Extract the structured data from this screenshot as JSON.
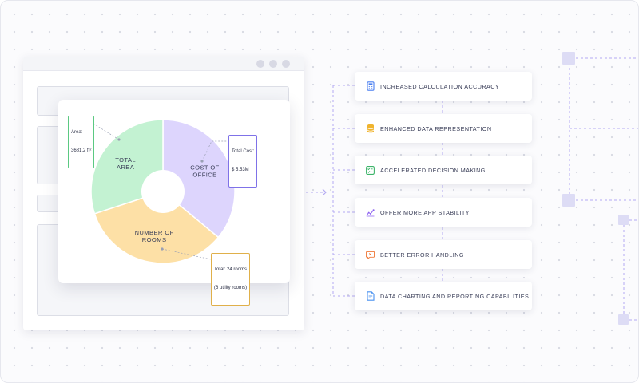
{
  "chart_data": {
    "type": "pie",
    "title": "",
    "slices": [
      {
        "label": "COST OF OFFICE",
        "lines": [
          "COST OF",
          "OFFICE"
        ],
        "value": 36,
        "color": "#ddd5fd"
      },
      {
        "label": "NUMBER OF ROOMS",
        "lines": [
          "NUMBER OF",
          "ROOMS"
        ],
        "value": 34,
        "color": "#fde0a6"
      },
      {
        "label": "TOTAL AREA",
        "lines": [
          "TOTAL",
          "AREA"
        ],
        "value": 30,
        "color": "#c3f2d2"
      }
    ],
    "callouts": {
      "area": [
        "Area:",
        "3681.2 ft²"
      ],
      "cost": [
        "Total Cost:",
        "$ 5.53M"
      ],
      "rooms": [
        "Total: 24 rooms",
        "(6 utility rooms)"
      ]
    }
  },
  "colors": {
    "connector": "#b3a9f2",
    "node": "#dddcf5",
    "area_border": "#5bc982",
    "cost_border": "#7f72e8",
    "rooms_border": "#e0b04a"
  },
  "features": [
    {
      "label": "INCREASED CALCULATION ACCURACY",
      "icon": "calculator-icon",
      "color": "#4a7ff0"
    },
    {
      "label": "ENHANCED DATA REPRESENTATION",
      "icon": "database-icon",
      "color": "#f0b42e"
    },
    {
      "label": "ACCELERATED DECISION MAKING",
      "icon": "checklist-icon",
      "color": "#3fb56b"
    },
    {
      "label": "OFFER MORE APP STABILITY",
      "icon": "trend-chart-icon",
      "color": "#8a5ef0"
    },
    {
      "label": "BETTER ERROR HANDLING",
      "icon": "error-message-icon",
      "color": "#ef7a3a"
    },
    {
      "label": "DATA CHARTING AND REPORTING CAPABILITIES",
      "icon": "report-document-icon",
      "color": "#4a92f0"
    }
  ]
}
